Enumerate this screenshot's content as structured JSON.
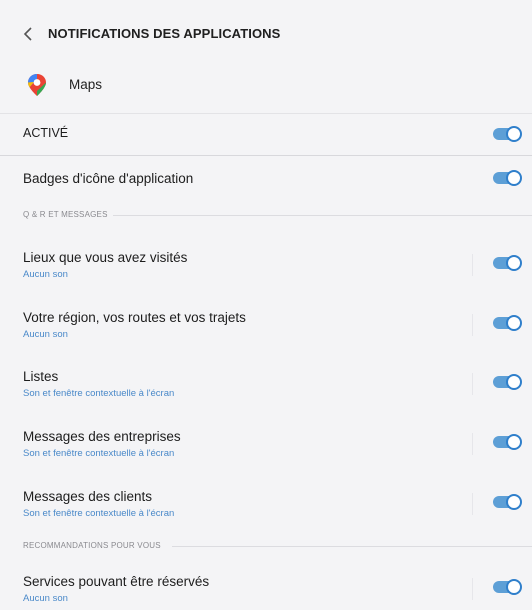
{
  "header": {
    "title": "NOTIFICATIONS DES APPLICATIONS",
    "back_icon": "chevron-left-icon"
  },
  "app": {
    "name": "Maps",
    "icon": "google-maps-pin-icon"
  },
  "accent_color": "#2f7fcb",
  "subtitle_color": "#4a89c9",
  "master": {
    "label": "ACTIVÉ",
    "on": true
  },
  "badges": {
    "label": "Badges d'icône d'application",
    "on": true
  },
  "sections": [
    {
      "title": "Q & R ET MESSAGES",
      "items": [
        {
          "label": "Lieux que vous avez visités",
          "sub": "Aucun son",
          "on": true
        },
        {
          "label": "Votre région, vos routes et vos trajets",
          "sub": "Aucun son",
          "on": true
        },
        {
          "label": "Listes",
          "sub": "Son et fenêtre contextuelle à l'écran",
          "on": true
        },
        {
          "label": "Messages des entreprises",
          "sub": "Son et fenêtre contextuelle à l'écran",
          "on": true
        },
        {
          "label": "Messages des clients",
          "sub": "Son et fenêtre contextuelle à l'écran",
          "on": true
        }
      ]
    },
    {
      "title": "RECOMMANDATIONS POUR VOUS",
      "items": [
        {
          "label": "Services pouvant être réservés",
          "sub": "Aucun son",
          "on": true
        }
      ]
    }
  ]
}
